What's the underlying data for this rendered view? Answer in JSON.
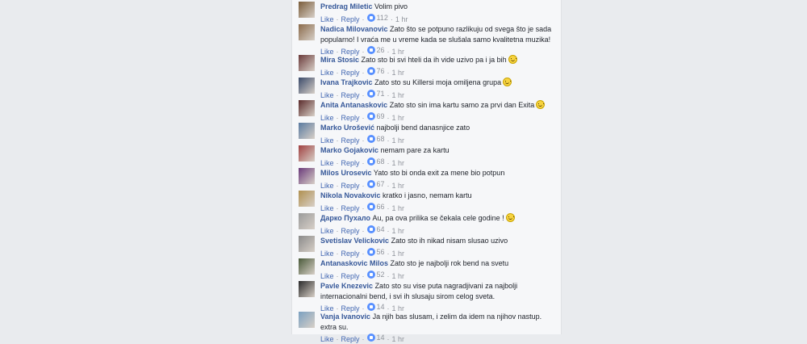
{
  "labels": {
    "like": "Like",
    "reply": "Reply"
  },
  "comments": [
    {
      "name": "Predrag Miletic",
      "text": "Volim pivo",
      "likes": "112",
      "time": "1 hr",
      "emoji": false,
      "avatar_color": "#7a5c3a"
    },
    {
      "name": "Nadica Milovanovic",
      "text": "Zato što se potpuno razlikuju od svega što je sada popularno! I vraća me u vreme kada se slušala samo kvalitetna muzika!",
      "likes": "26",
      "time": "1 hr",
      "emoji": false,
      "avatar_color": "#8a6a4a"
    },
    {
      "name": "Mira Stosic",
      "text": "Zato sto bi svi hteli da ih vide uzivo pa i ja bih",
      "likes": "76",
      "time": "1 hr",
      "emoji": true,
      "avatar_color": "#6a3a3a"
    },
    {
      "name": "Ivana Trajkovic",
      "text": "Zato sto su Killersi moja omiljena grupa",
      "likes": "71",
      "time": "1 hr",
      "emoji": true,
      "avatar_color": "#3a4a6a"
    },
    {
      "name": "Anita Antanaskovic",
      "text": "Zato sto sin ima kartu samo za prvi dan Exita",
      "likes": "69",
      "time": "1 hr",
      "emoji": true,
      "avatar_color": "#5a2a2a"
    },
    {
      "name": "Marko Urošević",
      "text": "najbolji bend danasnjice zato",
      "likes": "68",
      "time": "1 hr",
      "emoji": false,
      "avatar_color": "#5a7aa0"
    },
    {
      "name": "Marko Gojakovic",
      "text": "nemam pare za kartu",
      "likes": "68",
      "time": "1 hr",
      "emoji": false,
      "avatar_color": "#a04040"
    },
    {
      "name": "Milos Urosevic",
      "text": "Yato sto bi onda exit za mene bio potpun",
      "likes": "67",
      "time": "1 hr",
      "emoji": false,
      "avatar_color": "#6a3a7a"
    },
    {
      "name": "Nikola Novakovic",
      "text": "kratko i jasno, nemam kartu",
      "likes": "66",
      "time": "1 hr",
      "emoji": false,
      "avatar_color": "#b09050"
    },
    {
      "name": "Дарко Пухало",
      "text": "Au, pa ova prilika se čekala cele godine !",
      "likes": "64",
      "time": "1 hr",
      "emoji": true,
      "avatar_color": "#9a9a9a"
    },
    {
      "name": "Svetislav Velickovic",
      "text": "Zato sto ih nikad nisam slusao uzivo",
      "likes": "56",
      "time": "1 hr",
      "emoji": false,
      "avatar_color": "#8a8a8a"
    },
    {
      "name": "Antanaskovic Milos",
      "text": "Zato sto je najbolji rok bend na svetu",
      "likes": "52",
      "time": "1 hr",
      "emoji": false,
      "avatar_color": "#4a5a3a"
    },
    {
      "name": "Pavle Knezevic",
      "text": "Zato sto su vise puta nagradjivani za najbolji internacionalni bend, i svi ih slusaju sirom celog sveta.",
      "likes": "14",
      "time": "1 hr",
      "emoji": false,
      "avatar_color": "#2a2a2a"
    },
    {
      "name": "Vanja Ivanovic",
      "text": "Ja njih bas slusam, i zelim da idem na njihov nastup. extra su.",
      "likes": "14",
      "time": "1 hr",
      "emoji": false,
      "avatar_color": "#7aa0c0"
    }
  ]
}
